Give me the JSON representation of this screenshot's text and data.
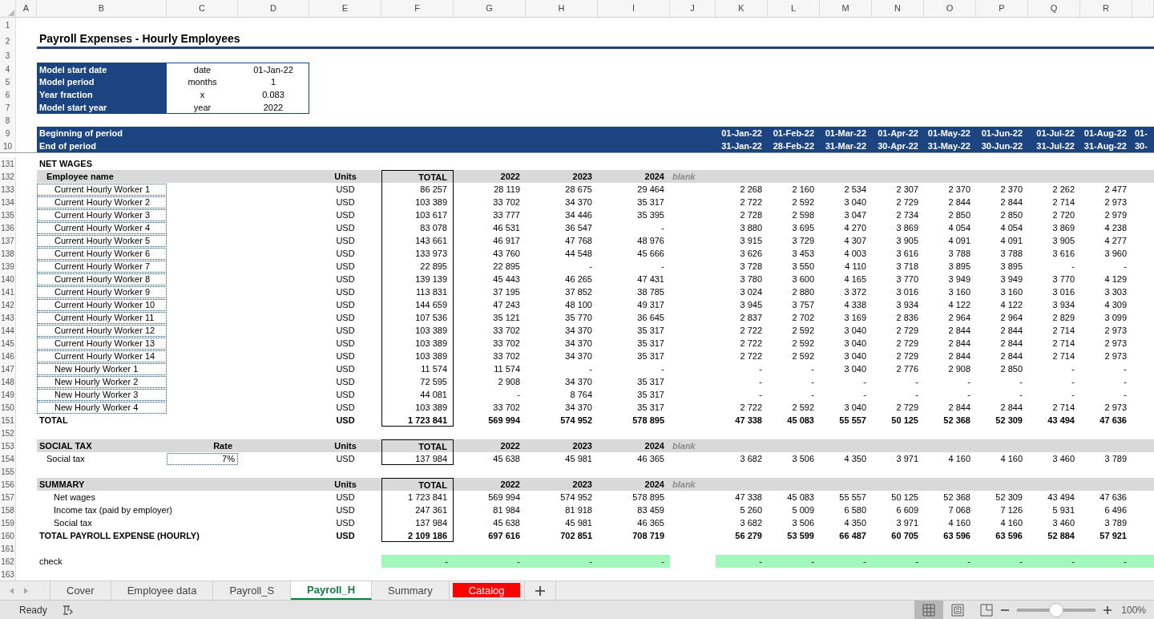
{
  "column_headers": [
    "A",
    "B",
    "C",
    "D",
    "E",
    "F",
    "G",
    "H",
    "I",
    "J",
    "K",
    "L",
    "M",
    "N",
    "O",
    "P",
    "Q",
    "R"
  ],
  "row_numbers": [
    "1",
    "2",
    "3",
    "4",
    "5",
    "6",
    "7",
    "8",
    "9",
    "10",
    "131",
    "132",
    "133",
    "134",
    "135",
    "136",
    "137",
    "138",
    "139",
    "140",
    "141",
    "142",
    "143",
    "144",
    "145",
    "146",
    "147",
    "148",
    "149",
    "150",
    "151",
    "152",
    "153",
    "154",
    "155",
    "156",
    "157",
    "158",
    "159",
    "160",
    "161",
    "162",
    "163"
  ],
  "title": "Payroll Expenses - Hourly Employees",
  "model_params": [
    {
      "label": "Model start date",
      "unit": "date",
      "value": "01-Jan-22"
    },
    {
      "label": "Model period",
      "unit": "months",
      "value": "1"
    },
    {
      "label": "Year fraction",
      "unit": "x",
      "value": "0.083"
    },
    {
      "label": "Model start year",
      "unit": "year",
      "value": "2022"
    }
  ],
  "period_rows": [
    {
      "label": "Beginning of period",
      "dates": [
        "01-Jan-22",
        "01-Feb-22",
        "01-Mar-22",
        "01-Apr-22",
        "01-May-22",
        "01-Jun-22",
        "01-Jul-22",
        "01-Aug-22",
        "01-"
      ]
    },
    {
      "label": "End of period",
      "dates": [
        "31-Jan-22",
        "28-Feb-22",
        "31-Mar-22",
        "30-Apr-22",
        "31-May-22",
        "30-Jun-22",
        "31-Jul-22",
        "31-Aug-22",
        "30-"
      ]
    }
  ],
  "sections": [
    {
      "title": "NET WAGES",
      "header": {
        "label": "Employee name",
        "units": "Units",
        "total": "TOTAL",
        "years": [
          "2022",
          "2023",
          "2024"
        ],
        "blank": "blank"
      },
      "rows": [
        {
          "kind": "employee",
          "name": "Current Hourly Worker 1",
          "units": "USD",
          "total": "86 257",
          "years": [
            "28 119",
            "28 675",
            "29 464"
          ],
          "months": [
            "2 268",
            "2 160",
            "2 534",
            "2 307",
            "2 370",
            "2 370",
            "2 262",
            "2 477"
          ]
        },
        {
          "kind": "employee",
          "name": "Current Hourly Worker 2",
          "units": "USD",
          "total": "103 389",
          "years": [
            "33 702",
            "34 370",
            "35 317"
          ],
          "months": [
            "2 722",
            "2 592",
            "3 040",
            "2 729",
            "2 844",
            "2 844",
            "2 714",
            "2 973"
          ]
        },
        {
          "kind": "employee",
          "name": "Current Hourly Worker 3",
          "units": "USD",
          "total": "103 617",
          "years": [
            "33 777",
            "34 446",
            "35 395"
          ],
          "months": [
            "2 728",
            "2 598",
            "3 047",
            "2 734",
            "2 850",
            "2 850",
            "2 720",
            "2 979"
          ]
        },
        {
          "kind": "employee",
          "name": "Current Hourly Worker 4",
          "units": "USD",
          "total": "83 078",
          "years": [
            "46 531",
            "36 547",
            "-"
          ],
          "months": [
            "3 880",
            "3 695",
            "4 270",
            "3 869",
            "4 054",
            "4 054",
            "3 869",
            "4 238"
          ]
        },
        {
          "kind": "employee",
          "name": "Current Hourly Worker 5",
          "units": "USD",
          "total": "143 661",
          "years": [
            "46 917",
            "47 768",
            "48 976"
          ],
          "months": [
            "3 915",
            "3 729",
            "4 307",
            "3 905",
            "4 091",
            "4 091",
            "3 905",
            "4 277"
          ]
        },
        {
          "kind": "employee",
          "name": "Current Hourly Worker 6",
          "units": "USD",
          "total": "133 973",
          "years": [
            "43 760",
            "44 548",
            "45 666"
          ],
          "months": [
            "3 626",
            "3 453",
            "4 003",
            "3 616",
            "3 788",
            "3 788",
            "3 616",
            "3 960"
          ]
        },
        {
          "kind": "employee",
          "name": "Current Hourly Worker 7",
          "units": "USD",
          "total": "22 895",
          "years": [
            "22 895",
            "-",
            "-"
          ],
          "months": [
            "3 728",
            "3 550",
            "4 110",
            "3 718",
            "3 895",
            "3 895",
            "-",
            "-"
          ]
        },
        {
          "kind": "employee",
          "name": "Current Hourly Worker 8",
          "units": "USD",
          "total": "139 139",
          "years": [
            "45 443",
            "46 265",
            "47 431"
          ],
          "months": [
            "3 780",
            "3 600",
            "4 165",
            "3 770",
            "3 949",
            "3 949",
            "3 770",
            "4 129"
          ]
        },
        {
          "kind": "employee",
          "name": "Current Hourly Worker 9",
          "units": "USD",
          "total": "113 831",
          "years": [
            "37 195",
            "37 852",
            "38 785"
          ],
          "months": [
            "3 024",
            "2 880",
            "3 372",
            "3 016",
            "3 160",
            "3 160",
            "3 016",
            "3 303"
          ]
        },
        {
          "kind": "employee",
          "name": "Current Hourly Worker 10",
          "units": "USD",
          "total": "144 659",
          "years": [
            "47 243",
            "48 100",
            "49 317"
          ],
          "months": [
            "3 945",
            "3 757",
            "4 338",
            "3 934",
            "4 122",
            "4 122",
            "3 934",
            "4 309"
          ]
        },
        {
          "kind": "employee",
          "name": "Current Hourly Worker 11",
          "units": "USD",
          "total": "107 536",
          "years": [
            "35 121",
            "35 770",
            "36 645"
          ],
          "months": [
            "2 837",
            "2 702",
            "3 169",
            "2 836",
            "2 964",
            "2 964",
            "2 829",
            "3 099"
          ]
        },
        {
          "kind": "employee",
          "name": "Current Hourly Worker 12",
          "units": "USD",
          "total": "103 389",
          "years": [
            "33 702",
            "34 370",
            "35 317"
          ],
          "months": [
            "2 722",
            "2 592",
            "3 040",
            "2 729",
            "2 844",
            "2 844",
            "2 714",
            "2 973"
          ]
        },
        {
          "kind": "employee",
          "name": "Current Hourly Worker 13",
          "units": "USD",
          "total": "103 389",
          "years": [
            "33 702",
            "34 370",
            "35 317"
          ],
          "months": [
            "2 722",
            "2 592",
            "3 040",
            "2 729",
            "2 844",
            "2 844",
            "2 714",
            "2 973"
          ]
        },
        {
          "kind": "employee",
          "name": "Current Hourly Worker 14",
          "units": "USD",
          "total": "103 389",
          "years": [
            "33 702",
            "34 370",
            "35 317"
          ],
          "months": [
            "2 722",
            "2 592",
            "3 040",
            "2 729",
            "2 844",
            "2 844",
            "2 714",
            "2 973"
          ]
        },
        {
          "kind": "employee",
          "name": "New Hourly Worker 1",
          "units": "USD",
          "total": "11 574",
          "years": [
            "11 574",
            "-",
            "-"
          ],
          "months": [
            "-",
            "-",
            "3 040",
            "2 776",
            "2 908",
            "2 850",
            "-",
            "-"
          ]
        },
        {
          "kind": "employee",
          "name": "New Hourly Worker 2",
          "units": "USD",
          "total": "72 595",
          "years": [
            "2 908",
            "34 370",
            "35 317"
          ],
          "months": [
            "-",
            "-",
            "-",
            "-",
            "-",
            "-",
            "-",
            "-"
          ]
        },
        {
          "kind": "employee",
          "name": "New Hourly Worker 3",
          "units": "USD",
          "total": "44 081",
          "years": [
            "-",
            "8 764",
            "35 317"
          ],
          "months": [
            "-",
            "-",
            "-",
            "-",
            "-",
            "-",
            "-",
            "-"
          ]
        },
        {
          "kind": "employee",
          "name": "New Hourly Worker 4",
          "units": "USD",
          "total": "103 389",
          "years": [
            "33 702",
            "34 370",
            "35 317"
          ],
          "months": [
            "2 722",
            "2 592",
            "3 040",
            "2 729",
            "2 844",
            "2 844",
            "2 714",
            "2 973"
          ]
        },
        {
          "kind": "total",
          "name": "TOTAL",
          "units": "USD",
          "total": "1 723 841",
          "years": [
            "569 994",
            "574 952",
            "578 895"
          ],
          "months": [
            "47 338",
            "45 083",
            "55 557",
            "50 125",
            "52 368",
            "52 309",
            "43 494",
            "47 636"
          ]
        }
      ]
    },
    {
      "header": {
        "label": "SOCIAL TAX",
        "rate_label": "Rate",
        "units": "Units",
        "total": "TOTAL",
        "years": [
          "2022",
          "2023",
          "2024"
        ],
        "blank": "blank"
      },
      "rows": [
        {
          "kind": "tax",
          "name": "Social tax",
          "rate": "7%",
          "units": "USD",
          "total": "137 984",
          "years": [
            "45 638",
            "45 981",
            "46 365"
          ],
          "months": [
            "3 682",
            "3 506",
            "4 350",
            "3 971",
            "4 160",
            "4 160",
            "3 460",
            "3 789"
          ]
        }
      ]
    },
    {
      "header": {
        "label": "SUMMARY",
        "units": "Units",
        "total": "TOTAL",
        "years": [
          "2022",
          "2023",
          "2024"
        ],
        "blank": "blank"
      },
      "rows": [
        {
          "kind": "item",
          "name": "Net wages",
          "units": "USD",
          "total": "1 723 841",
          "years": [
            "569 994",
            "574 952",
            "578 895"
          ],
          "months": [
            "47 338",
            "45 083",
            "55 557",
            "50 125",
            "52 368",
            "52 309",
            "43 494",
            "47 636"
          ]
        },
        {
          "kind": "item",
          "name": "Income tax (paid by employer)",
          "units": "USD",
          "total": "247 361",
          "years": [
            "81 984",
            "81 918",
            "83 459"
          ],
          "months": [
            "5 260",
            "5 009",
            "6 580",
            "6 609",
            "7 068",
            "7 126",
            "5 931",
            "6 496"
          ]
        },
        {
          "kind": "item",
          "name": "Social tax",
          "units": "USD",
          "total": "137 984",
          "years": [
            "45 638",
            "45 981",
            "46 365"
          ],
          "months": [
            "3 682",
            "3 506",
            "4 350",
            "3 971",
            "4 160",
            "4 160",
            "3 460",
            "3 789"
          ]
        },
        {
          "kind": "total",
          "name": "TOTAL PAYROLL EXPENSE (HOURLY)",
          "units": "USD",
          "total": "2 109 186",
          "years": [
            "697 616",
            "702 851",
            "708 719"
          ],
          "months": [
            "56 279",
            "53 599",
            "66 487",
            "60 705",
            "63 596",
            "63 596",
            "52 884",
            "57 921"
          ]
        }
      ]
    }
  ],
  "check": {
    "label": "check",
    "values": [
      "-",
      "-",
      "-",
      "-"
    ],
    "months": [
      "-",
      "-",
      "-",
      "-",
      "-",
      "-",
      "-",
      "-"
    ]
  },
  "sheet_tabs": [
    {
      "label": "Cover",
      "selected": false
    },
    {
      "label": "Employee data",
      "selected": false
    },
    {
      "label": "Payroll_S",
      "selected": false
    },
    {
      "label": "Payroll_H",
      "selected": true
    },
    {
      "label": "Summary",
      "selected": false
    },
    {
      "label": "Catalog",
      "selected": false,
      "color": "#ff0000"
    }
  ],
  "status_bar": {
    "mode": "Ready",
    "views": [
      {
        "kind": "normal",
        "selected": true
      },
      {
        "kind": "layout",
        "selected": false
      },
      {
        "kind": "break",
        "selected": false
      }
    ],
    "zoom_slider": {
      "level": 0.5
    },
    "zoom": "100%"
  }
}
